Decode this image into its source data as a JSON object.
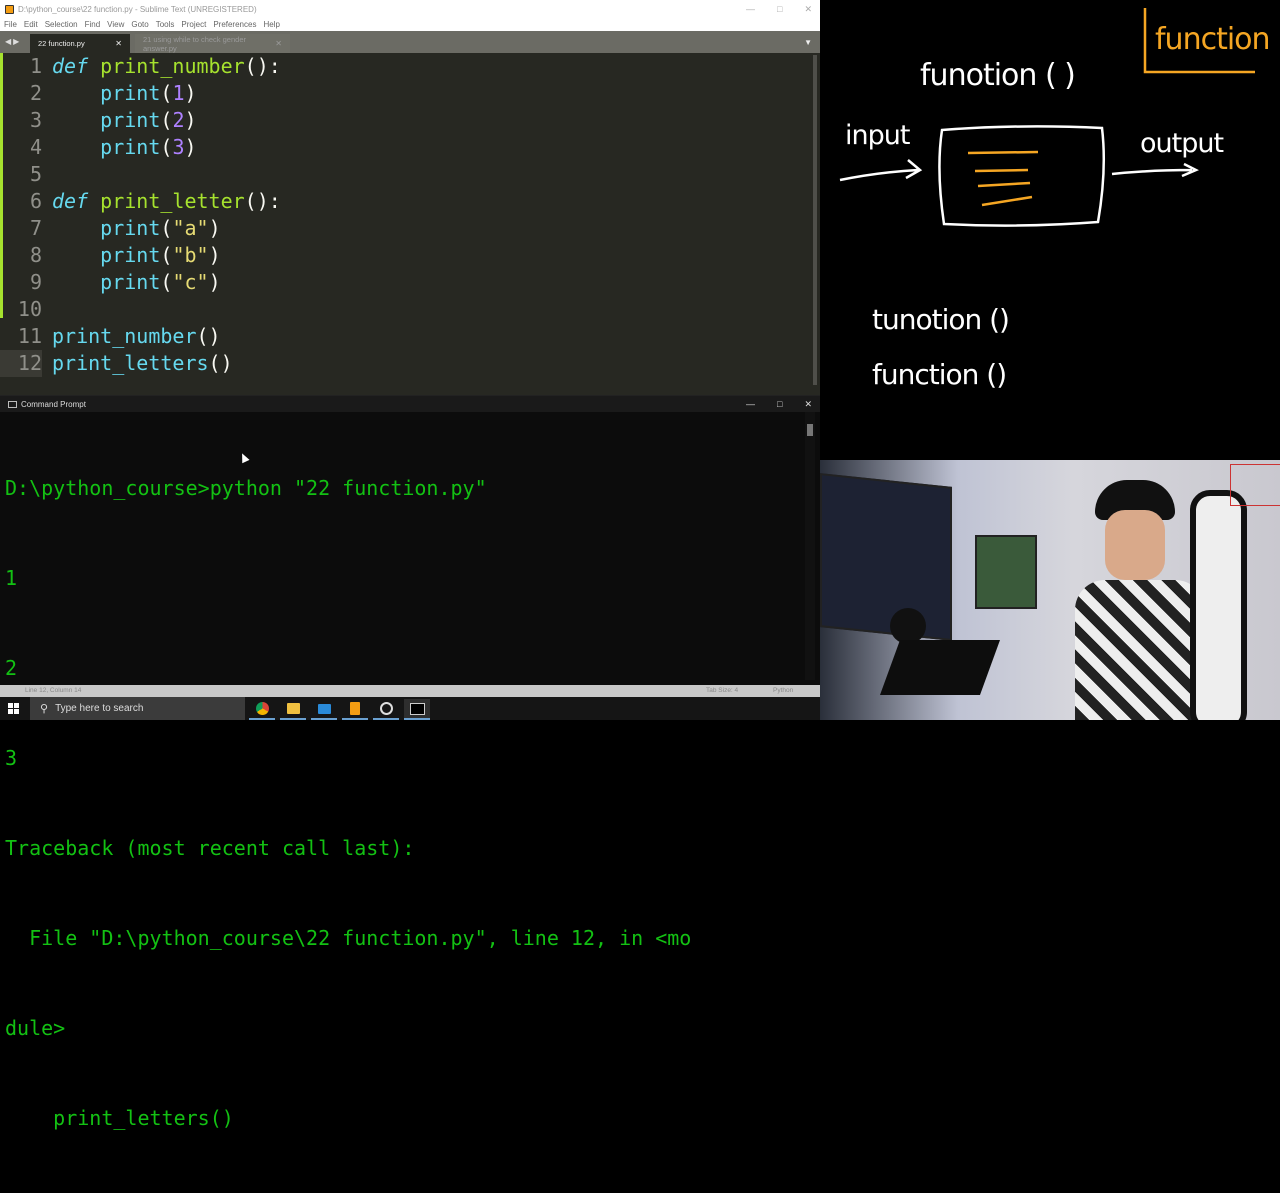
{
  "sublime": {
    "title": "D:\\python_course\\22 function.py - Sublime Text (UNREGISTERED)",
    "menu": [
      "File",
      "Edit",
      "Selection",
      "Find",
      "View",
      "Goto",
      "Tools",
      "Project",
      "Preferences",
      "Help"
    ],
    "tabs": [
      {
        "label": "22 function.py",
        "active": true
      },
      {
        "label": "21 using while to check gender answer.py",
        "active": false
      }
    ],
    "lines": [
      {
        "n": "1",
        "code": "def print_number():"
      },
      {
        "n": "2",
        "code": "    print(1)"
      },
      {
        "n": "3",
        "code": "    print(2)"
      },
      {
        "n": "4",
        "code": "    print(3)"
      },
      {
        "n": "5",
        "code": ""
      },
      {
        "n": "6",
        "code": "def print_letter():"
      },
      {
        "n": "7",
        "code": "    print(\"a\")"
      },
      {
        "n": "8",
        "code": "    print(\"b\")"
      },
      {
        "n": "9",
        "code": "    print(\"c\")"
      },
      {
        "n": "10",
        "code": ""
      },
      {
        "n": "11",
        "code": "print_number()"
      },
      {
        "n": "12",
        "code": "print_letters()"
      }
    ],
    "status": {
      "position": "Line 12, Column 14",
      "tab_size": "Tab Size: 4",
      "syntax": "Python"
    }
  },
  "cmd": {
    "title": "Command Prompt",
    "output": [
      "D:\\python_course>python \"22 function.py\"",
      "1",
      "2",
      "3",
      "Traceback (most recent call last):",
      "  File \"D:\\python_course\\22 function.py\", line 12, in <mo",
      "dule>",
      "    print_letters()"
    ]
  },
  "taskbar": {
    "search_placeholder": "Type here to search",
    "apps": [
      "chrome-icon",
      "file-explorer-icon",
      "mail-icon",
      "sublime-text-icon",
      "obs-icon",
      "command-prompt-icon"
    ]
  },
  "board": {
    "heading": "function",
    "diagram_label": "funotion ( )",
    "input_label": "input",
    "output_label": "output",
    "note1": "tunotion ()",
    "note2": "function ()"
  },
  "colors": {
    "accent_green": "#13c113",
    "sublime_bg": "#272822",
    "orange": "#f5a623"
  }
}
